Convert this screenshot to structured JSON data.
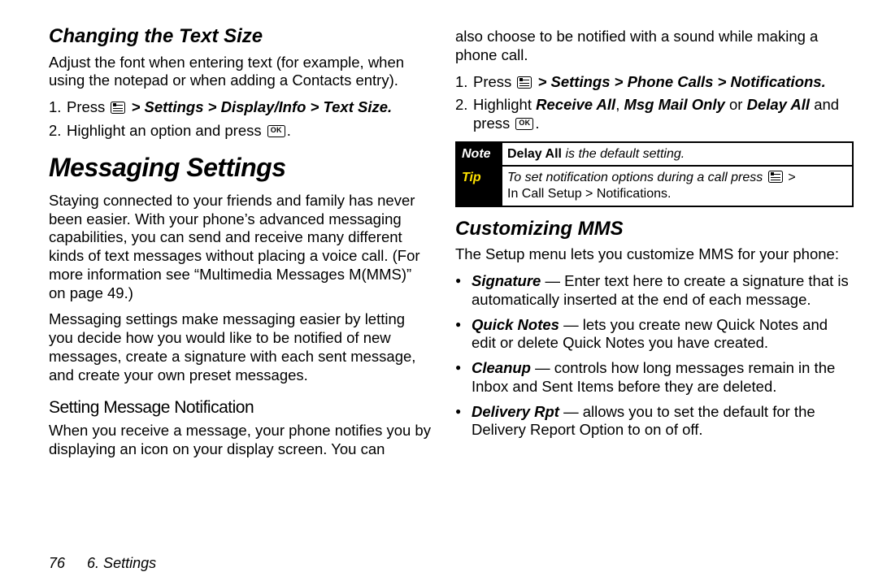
{
  "left": {
    "h_textsize": "Changing the Text Size",
    "textsize_para": "Adjust the font when entering text (for example, when using the notepad or when adding a Contacts entry).",
    "ts_step1_pre": "Press",
    "ts_step1_path": " > Settings > Display/Info > Text Size.",
    "ts_step2_pre": "Highlight an option and press ",
    "ts_step2_post": ".",
    "h_messaging": "Messaging Settings",
    "msg_para1": "Staying connected to your friends and family has never been easier. With your phone’s advanced messaging capabilities, you can send and receive many different kinds of text messages without placing a voice call. (For more information see “Multimedia Messages M(MMS)” on page 49.)",
    "msg_para2": "Messaging settings make messaging easier by letting you decide how you would like to be notified of new messages, create a signature with each sent message, and create your own preset messages.",
    "h_setting_notif": "Setting Message Notification",
    "notif_para": "When you receive a message, your phone notifies you by displaying an icon on your display screen. You can"
  },
  "right": {
    "cont_para": "also choose to be notified with a sound while making a phone call.",
    "r_step1_pre": "Press",
    "r_step1_path": " > Settings > Phone Calls > Notifications.",
    "r_step2_a": "Highlight ",
    "r_step2_opt1": "Receive All",
    "r_step2_sep1": ", ",
    "r_step2_opt2": "Msg Mail Only",
    "r_step2_sep2": " or ",
    "r_step2_opt3": "Delay All",
    "r_step2_b": " and press ",
    "r_step2_c": ".",
    "note_label": "Note",
    "note1_b": "Delay All",
    "note1_rest": " is the default setting.",
    "tip_label": "Tip",
    "tip_a": "To set notification options during a call press ",
    "tip_b": " >",
    "tip_c": "In Call Setup > Notifications.",
    "h_mms": "Customizing MMS",
    "mms_para": "The Setup menu lets you customize MMS for your phone:",
    "bul1_b": "Signature",
    "bul1_rest": " — Enter text here to create a signature that is automatically inserted at the end of each message.",
    "bul2_b": "Quick Notes",
    "bul2_rest": " — lets you create new Quick Notes and edit or delete Quick Notes you have created.",
    "bul3_b": "Cleanup",
    "bul3_rest": " — controls how long messages remain in the Inbox and Sent Items before they are deleted.",
    "bul4_b": "Delivery Rpt",
    "bul4_rest": " — allows you to set the default for the Delivery Report Option to on of off."
  },
  "footer": {
    "page": "76",
    "section": "6. Settings"
  }
}
